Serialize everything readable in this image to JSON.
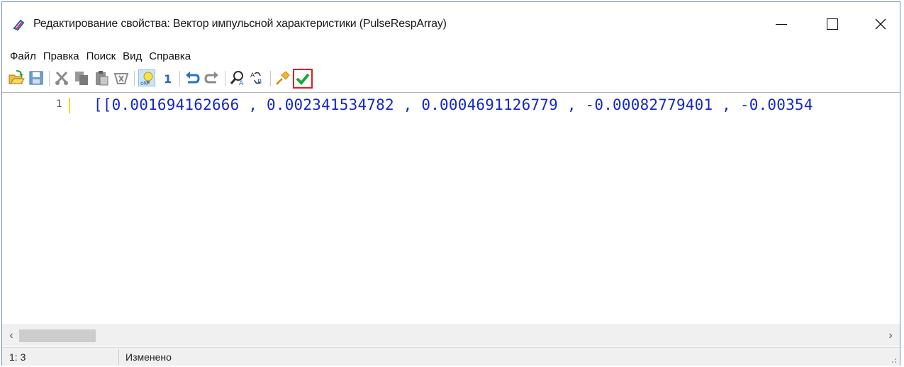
{
  "window": {
    "title": "Редактирование свойства: Вектор импульсной характеристики (PulseRespArray)",
    "app_icon": "app-icon",
    "controls": [
      "minimize-icon",
      "maximize-icon",
      "close-icon"
    ]
  },
  "menu": {
    "items": [
      "Файл",
      "Правка",
      "Поиск",
      "Вид",
      "Справка"
    ]
  },
  "toolbar": {
    "buttons": [
      {
        "icon": "open-icon"
      },
      {
        "icon": "save-icon"
      },
      {
        "icon": "cut-icon"
      },
      {
        "icon": "copy-icon"
      },
      {
        "icon": "paste-icon"
      },
      {
        "icon": "delete-icon"
      },
      {
        "icon": "hint-bulb-icon",
        "state": "active"
      },
      {
        "icon": "line-number-icon"
      },
      {
        "icon": "undo-icon"
      },
      {
        "icon": "redo-icon"
      },
      {
        "icon": "find-icon"
      },
      {
        "icon": "replace-icon"
      },
      {
        "icon": "pin-icon"
      },
      {
        "icon": "apply-check-icon",
        "state": "highlighted"
      }
    ],
    "accent_color": "#e01c1c"
  },
  "editor": {
    "line_number": "1",
    "line_text": "[[0.001694162666 , 0.002341534782 , 0.0004691126779 , -0.00082779401 , -0.00354",
    "number_color": "#1428c8"
  },
  "statusbar": {
    "position": "1: 3",
    "state": "Изменено"
  }
}
